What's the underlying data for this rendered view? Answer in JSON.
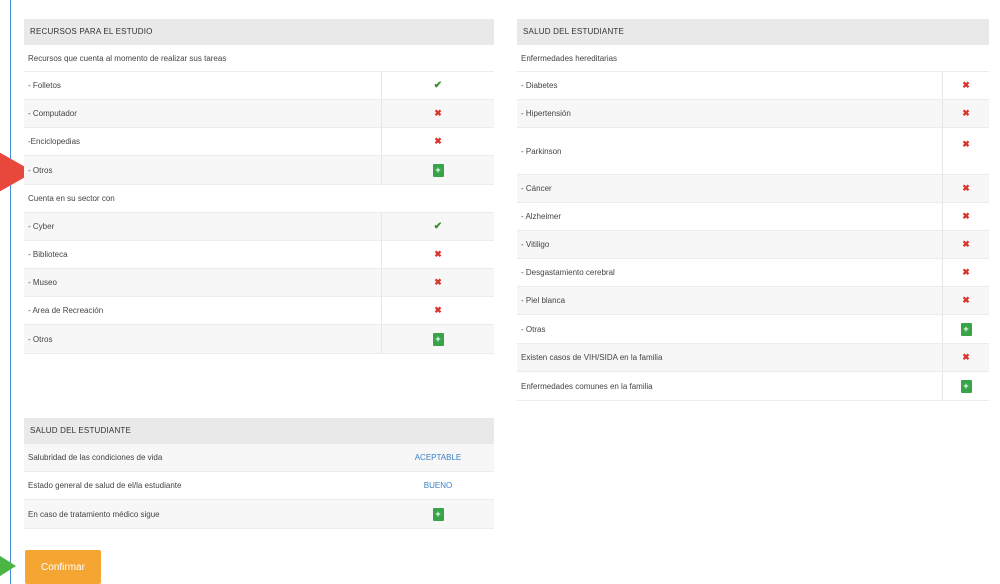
{
  "left_panel": {
    "title": "RECURSOS PARA EL ESTUDIO",
    "section1": "Recursos que cuenta al momento de realizar sus tareas",
    "items1": [
      {
        "label": "- Folletos",
        "status": "check"
      },
      {
        "label": "- Computador",
        "status": "cross"
      },
      {
        "label": "-Enciclopedias",
        "status": "cross"
      },
      {
        "label": "- Otros",
        "status": "plus"
      }
    ],
    "section2": "Cuenta en  su sector con",
    "items2": [
      {
        "label": "- Cyber",
        "status": "check"
      },
      {
        "label": "- Biblioteca",
        "status": "cross"
      },
      {
        "label": "- Museo",
        "status": "cross"
      },
      {
        "label": "- Area de Recreación",
        "status": "cross"
      },
      {
        "label": "- Otros",
        "status": "plus"
      }
    ]
  },
  "right_panel": {
    "title": "SALUD DEL ESTUDIANTE",
    "section": "Enfermedades hereditarias",
    "items": [
      {
        "label": "- Diabetes",
        "status": "cross"
      },
      {
        "label": "- Hipertensión",
        "status": "cross"
      },
      {
        "label": "- Parkinson",
        "status": "cross"
      },
      {
        "label": "- Cáncer",
        "status": "cross"
      },
      {
        "label": "- Alzheimer",
        "status": "cross"
      },
      {
        "label": "- Vitiligo",
        "status": "cross"
      },
      {
        "label": "- Desgastamiento cerebral",
        "status": "cross"
      },
      {
        "label": "- Piel blanca",
        "status": "cross"
      },
      {
        "label": "- Otras",
        "status": "plus"
      },
      {
        "label": "Existen casos de VIH/SIDA en la familia",
        "status": "cross"
      },
      {
        "label": "Enfermedades comunes en la familia",
        "status": "plus"
      }
    ]
  },
  "bottom_panel": {
    "title": "SALUD DEL ESTUDIANTE",
    "items": [
      {
        "label": "Salubridad de las condiciones de vida",
        "value": "ACEPTABLE"
      },
      {
        "label": "Estado general de salud de el/la estudiante",
        "value": "BUENO"
      },
      {
        "label": "En caso de tratamiento médico sigue",
        "value": "+"
      }
    ]
  },
  "symbols": {
    "check": "✔",
    "cross": "✖",
    "plus": "+"
  },
  "colors": {
    "check": "#3a8d2b",
    "cross": "#d9342b",
    "plus_button": "#37a447",
    "confirm_button": "#f5a531",
    "value_link": "#3a7fc1"
  },
  "confirm_label": "Confirmar"
}
